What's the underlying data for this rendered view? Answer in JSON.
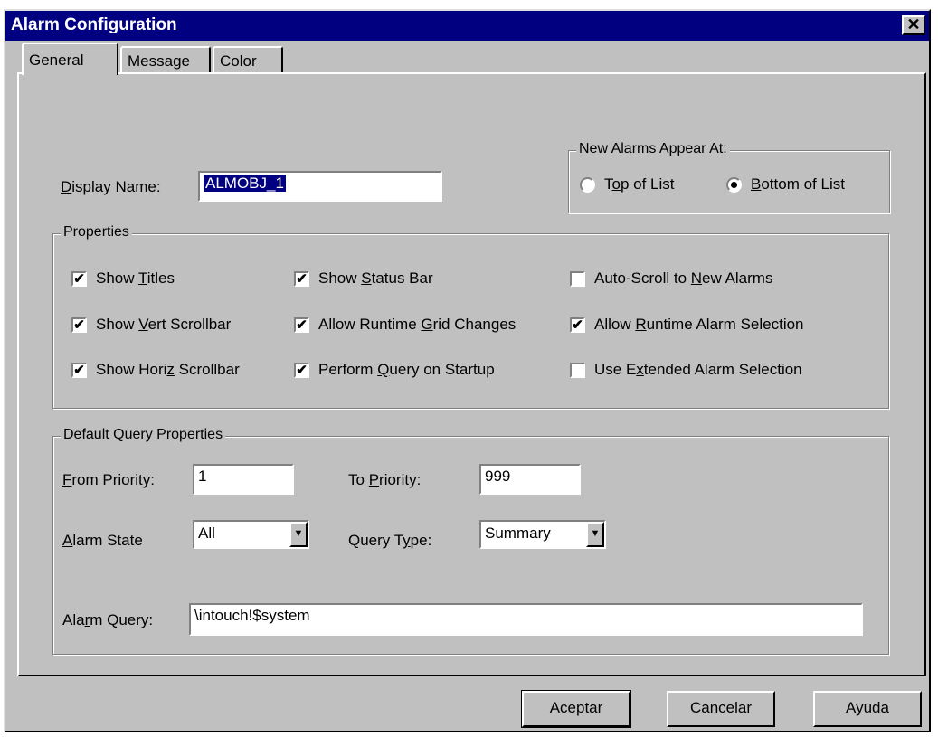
{
  "window": {
    "title": "Alarm Configuration",
    "close_label": "✕"
  },
  "tabs": [
    {
      "label": "General",
      "active": true
    },
    {
      "label": "Message",
      "active": false
    },
    {
      "label": "Color",
      "active": false
    }
  ],
  "display_name": {
    "label_pre": "D",
    "label_rest": "isplay Name:",
    "value": "ALMOBJ_1"
  },
  "new_alarms": {
    "legend": "New Alarms Appear At:",
    "top": {
      "pre": "T",
      "u": "o",
      "post": "p of List",
      "selected": false
    },
    "bottom": {
      "pre": "",
      "u": "B",
      "post": "ottom of List",
      "selected": true
    }
  },
  "properties": {
    "legend": "Properties",
    "checks": [
      {
        "pre": "Show ",
        "u": "T",
        "post": "itles",
        "checked": true
      },
      {
        "pre": "Show ",
        "u": "S",
        "post": "tatus Bar",
        "checked": true
      },
      {
        "pre": "Auto-Scroll to ",
        "u": "N",
        "post": "ew Alarms",
        "checked": false
      },
      {
        "pre": "Show ",
        "u": "V",
        "post": "ert Scrollbar",
        "checked": true
      },
      {
        "pre": "Allow Runtime ",
        "u": "G",
        "post": "rid Changes",
        "checked": true
      },
      {
        "pre": "Allow ",
        "u": "R",
        "post": "untime Alarm Selection",
        "checked": true
      },
      {
        "pre": "Show Hori",
        "u": "z",
        "post": " Scrollbar",
        "checked": true
      },
      {
        "pre": "Perform ",
        "u": "Q",
        "post": "uery on Startup",
        "checked": true
      },
      {
        "pre": "Use E",
        "u": "x",
        "post": "tended Alarm Selection",
        "checked": false
      }
    ]
  },
  "query": {
    "legend": "Default Query Properties",
    "from_priority": {
      "u": "F",
      "post": "rom Priority:",
      "value": "1"
    },
    "to_priority": {
      "pre": "To ",
      "u": "P",
      "post": "riority:",
      "value": "999"
    },
    "alarm_state": {
      "u": "A",
      "post": "larm State",
      "value": "All"
    },
    "query_type": {
      "pre": "Query T",
      "u": "y",
      "post": "pe:",
      "value": "Summary"
    },
    "alarm_query": {
      "pre": "Ala",
      "u": "r",
      "post": "m Query:",
      "value": "\\intouch!$system"
    }
  },
  "buttons": {
    "ok": "Aceptar",
    "cancel": "Cancelar",
    "help": "Ayuda"
  },
  "icons": {
    "check": "✔",
    "dropdown": "▼"
  }
}
